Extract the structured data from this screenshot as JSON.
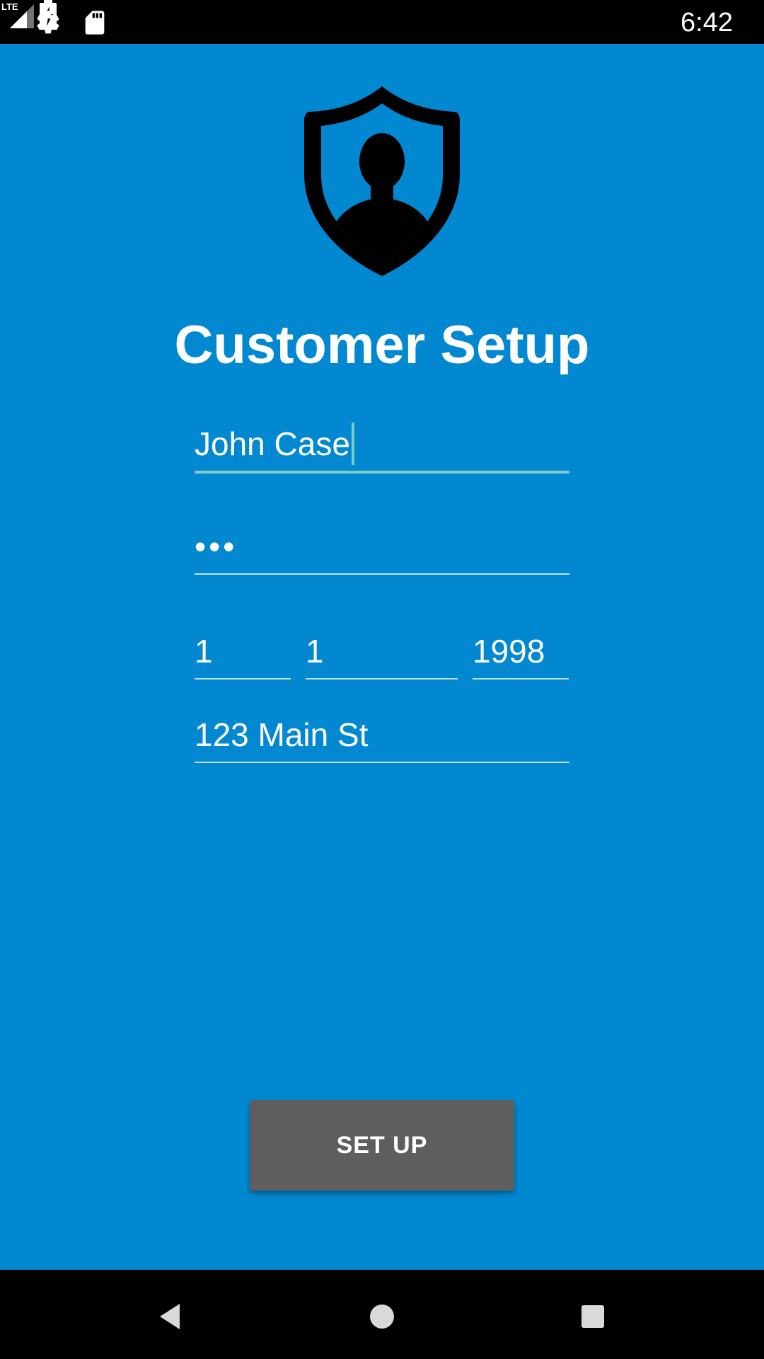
{
  "status_bar": {
    "time": "6:42",
    "network": "LTE",
    "icons": [
      "gear-icon",
      "sd-card-icon",
      "lte-signal-icon",
      "battery-charging-icon"
    ]
  },
  "logo": {
    "icon": "shield-user-icon"
  },
  "title": "Customer Setup",
  "form": {
    "name_value": "John Case",
    "password_value": "•••",
    "birth_day_value": "1",
    "birth_month_value": "1",
    "birth_year_value": "1998",
    "address_value": "123 Main St"
  },
  "setup_button_label": "SET UP",
  "nav_bar": {
    "icons": [
      "back-icon",
      "home-icon",
      "recents-icon"
    ]
  },
  "colors": {
    "background": "#0288D1",
    "button": "#5E5E5E",
    "focus_accent": "#80CBC4",
    "system_bars": "#000000"
  }
}
